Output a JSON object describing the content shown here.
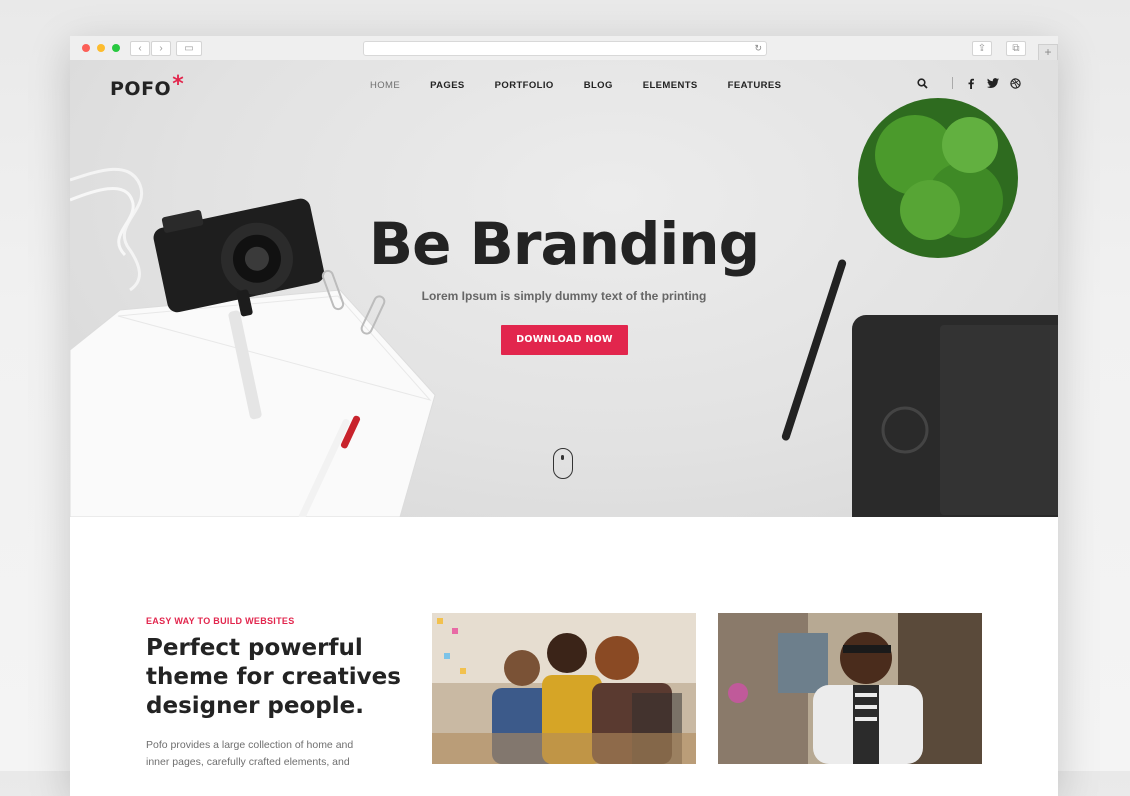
{
  "site": {
    "logo_text": "POFO",
    "logo_star": "*",
    "brand_color": "#e2264d"
  },
  "nav": {
    "items": [
      {
        "label": "HOME",
        "active": true
      },
      {
        "label": "PAGES"
      },
      {
        "label": "PORTFOLIO"
      },
      {
        "label": "BLOG"
      },
      {
        "label": "ELEMENTS"
      },
      {
        "label": "FEATURES"
      }
    ],
    "icons": [
      "search-icon",
      "facebook-icon",
      "twitter-icon",
      "dribbble-icon"
    ]
  },
  "hero": {
    "title": "Be Branding",
    "subtitle": "Lorem Ipsum is simply dummy text of the printing",
    "cta_label": "DOWNLOAD NOW"
  },
  "intro": {
    "kicker": "EASY WAY TO BUILD WEBSITES",
    "headline": "Perfect powerful theme for creatives designer people.",
    "body": "Pofo provides a large collection of home and inner pages, carefully crafted elements, and"
  },
  "browser": {
    "icons": [
      "back-icon",
      "forward-icon",
      "sidebar-icon",
      "reload-icon",
      "share-icon",
      "tabs-icon",
      "new-tab-icon"
    ]
  }
}
